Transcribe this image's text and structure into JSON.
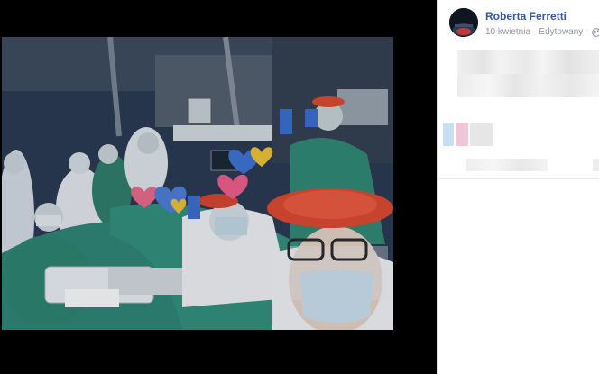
{
  "post": {
    "author": "Roberta Ferretti",
    "date": "10 kwietnia",
    "separator": "·",
    "edited": "Edytowany",
    "separator2": "·"
  },
  "icons": {
    "privacy": "globe-icon",
    "avatar": "profile-avatar"
  },
  "colors": {
    "author_link": "#385898",
    "meta_text": "#90949c",
    "viewer_bg": "#000000",
    "scrubs": "#2f8a74",
    "face_shield_hat": "#e2492e"
  }
}
